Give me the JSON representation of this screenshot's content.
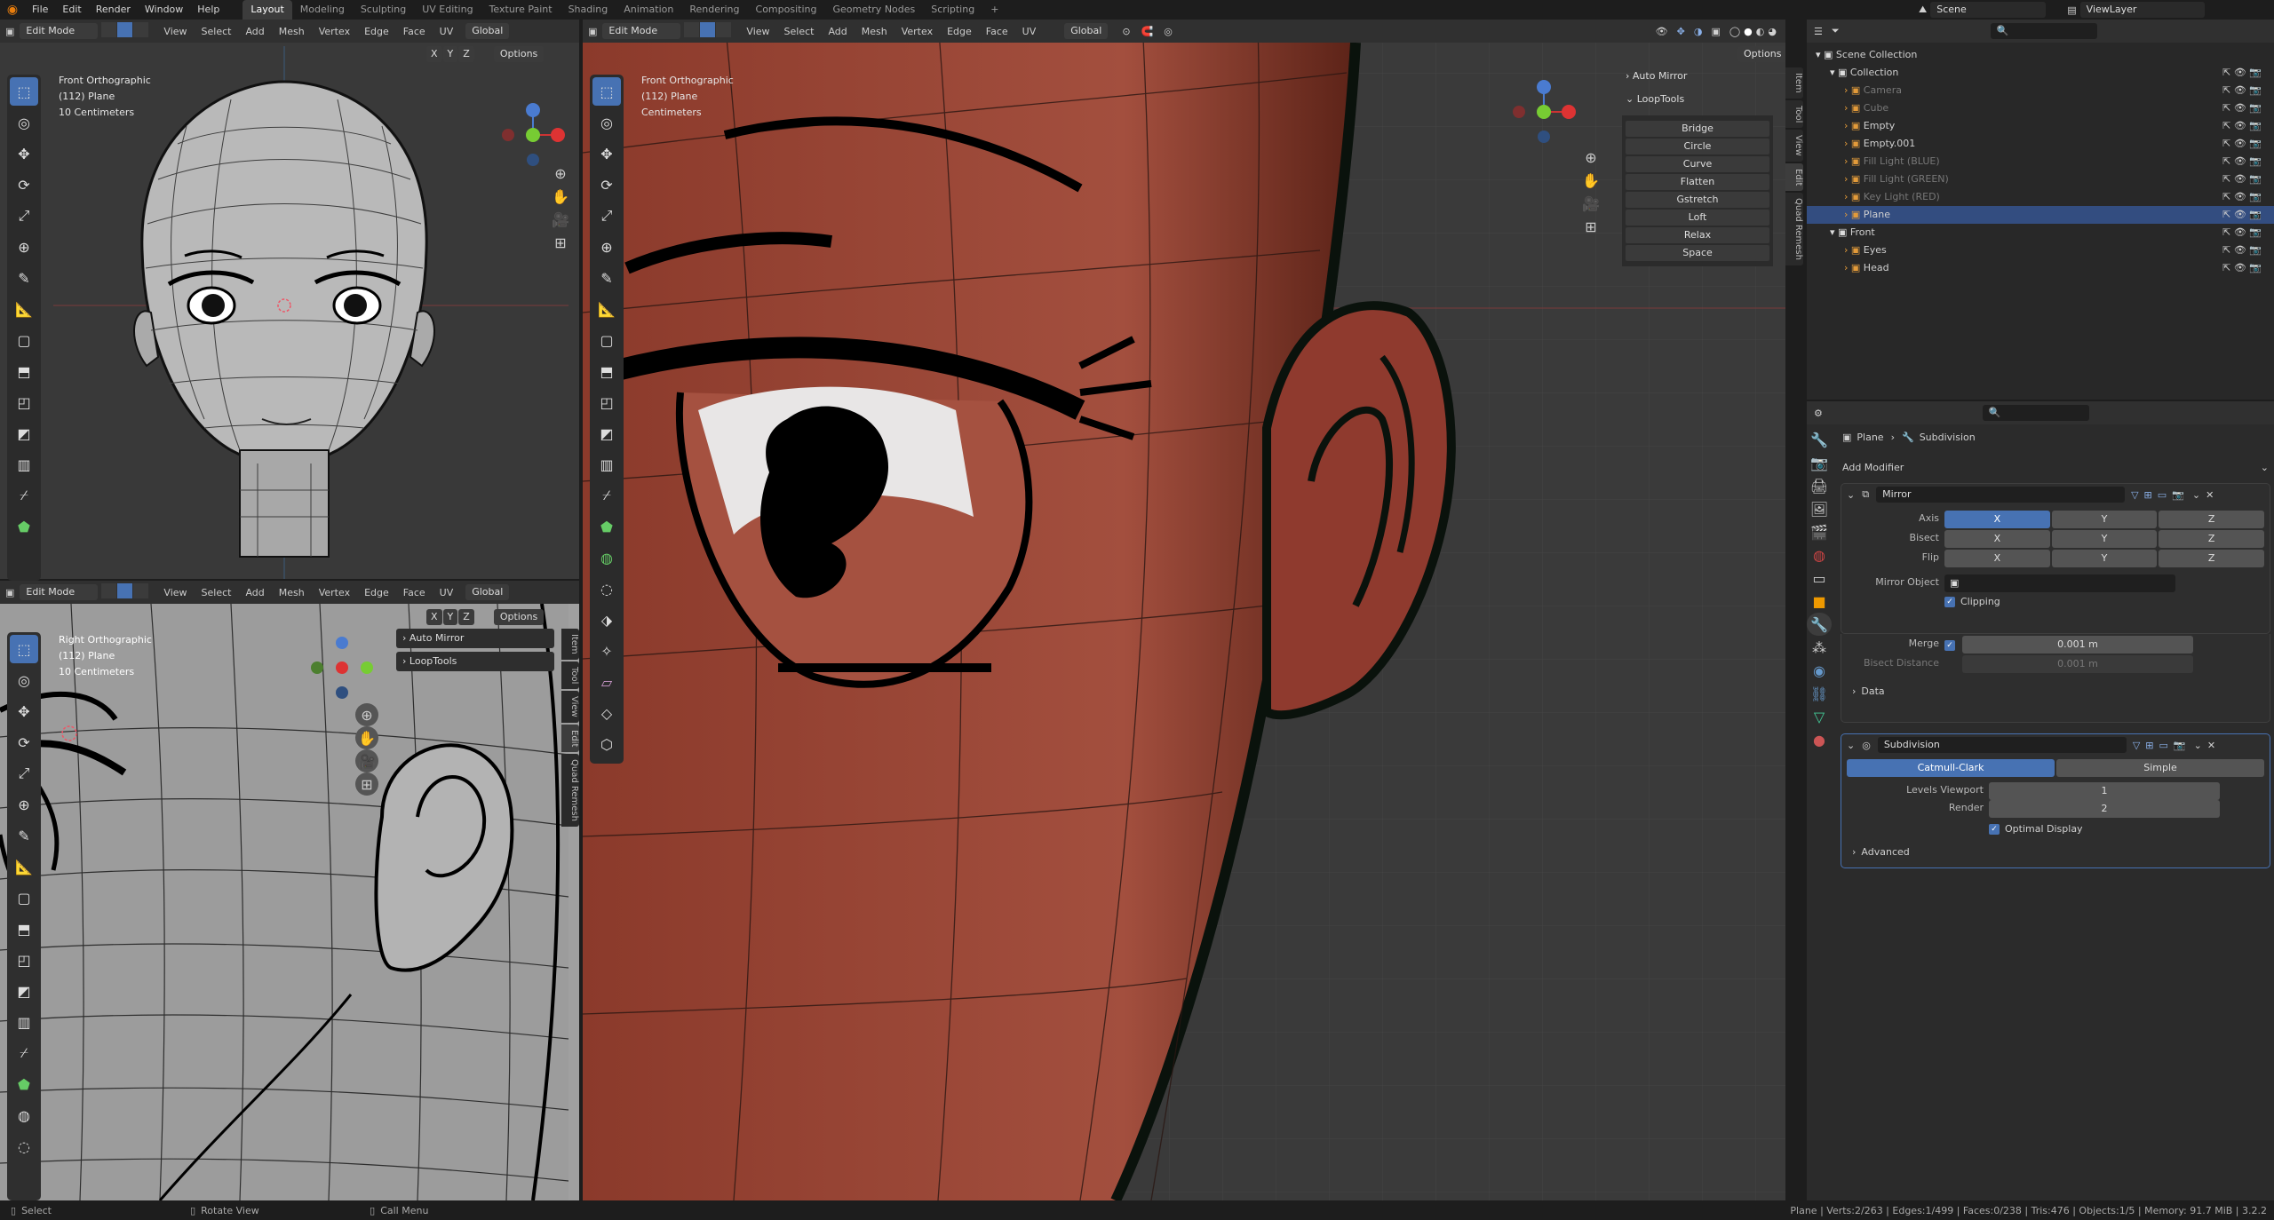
{
  "topbar": {
    "menus": [
      "File",
      "Edit",
      "Render",
      "Window",
      "Help"
    ],
    "workspaces": [
      "Layout",
      "Modeling",
      "Sculpting",
      "UV Editing",
      "Texture Paint",
      "Shading",
      "Animation",
      "Rendering",
      "Compositing",
      "Geometry Nodes",
      "Scripting"
    ],
    "active_workspace": "Layout",
    "add_tab": "+",
    "scene": "Scene",
    "view_layer": "ViewLayer"
  },
  "viewport_top_left": {
    "mode": "Edit Mode",
    "menus": [
      "View",
      "Select",
      "Add",
      "Mesh",
      "Vertex",
      "Edge",
      "Face",
      "UV"
    ],
    "orientation": "Global",
    "axes": [
      "X",
      "Y",
      "Z"
    ],
    "options": "Options",
    "overlay": [
      "Front Orthographic",
      "(112) Plane",
      "10 Centimeters"
    ]
  },
  "viewport_bottom_left": {
    "mode": "Edit Mode",
    "menus": [
      "View",
      "Select",
      "Add",
      "Mesh",
      "Vertex",
      "Edge",
      "Face",
      "UV"
    ],
    "orientation": "Global",
    "axes": [
      "X",
      "Y",
      "Z"
    ],
    "options": "Options",
    "overlay": [
      "Right Orthographic",
      "(112) Plane",
      "10 Centimeters"
    ],
    "panels": [
      "Auto Mirror",
      "LoopTools"
    ],
    "tabs": [
      "Item",
      "Tool",
      "View",
      "Edit",
      "Quad Remesh"
    ]
  },
  "viewport_main": {
    "mode": "Edit Mode",
    "menus": [
      "View",
      "Select",
      "Add",
      "Mesh",
      "Vertex",
      "Edge",
      "Face",
      "UV"
    ],
    "orientation": "Global",
    "options": "Options",
    "overlay": [
      "Front Orthographic",
      "(112) Plane",
      "Centimeters"
    ],
    "panel_auto_mirror": "Auto Mirror",
    "panel_looptools": "LoopTools",
    "looptools_buttons": [
      "Bridge",
      "Circle",
      "Curve",
      "Flatten",
      "Gstretch",
      "Loft",
      "Relax",
      "Space"
    ],
    "tabs": [
      "Item",
      "Tool",
      "View",
      "Edit",
      "Quad Remesh"
    ]
  },
  "outliner": {
    "rows": [
      {
        "label": "Scene Collection",
        "depth": 0
      },
      {
        "label": "Collection",
        "depth": 1
      },
      {
        "label": "Camera",
        "depth": 2,
        "dim": true
      },
      {
        "label": "Cube",
        "depth": 2,
        "dim": true
      },
      {
        "label": "Empty",
        "depth": 2
      },
      {
        "label": "Empty.001",
        "depth": 2
      },
      {
        "label": "Fill Light (BLUE)",
        "depth": 2,
        "dim": true
      },
      {
        "label": "Fill Light (GREEN)",
        "depth": 2,
        "dim": true
      },
      {
        "label": "Key Light (RED)",
        "depth": 2,
        "dim": true
      },
      {
        "label": "Plane",
        "depth": 2,
        "selected": true
      },
      {
        "label": "Front",
        "depth": 1
      },
      {
        "label": "Eyes",
        "depth": 2
      },
      {
        "label": "Head",
        "depth": 2
      }
    ]
  },
  "properties": {
    "breadcrumb_object": "Plane",
    "breadcrumb_modifier": "Subdivision",
    "add_modifier": "Add Modifier",
    "mirror": {
      "name": "Mirror",
      "axis_label": "Axis",
      "bisect_label": "Bisect",
      "flip_label": "Flip",
      "xyz": [
        "X",
        "Y",
        "Z"
      ],
      "mirror_object_label": "Mirror Object",
      "clipping": "Clipping",
      "merge_label": "Merge",
      "merge_value": "0.001 m",
      "bisect_distance_label": "Bisect Distance",
      "bisect_distance_value": "0.001 m",
      "data": "Data"
    },
    "subdivision": {
      "name": "Subdivision",
      "catmull": "Catmull-Clark",
      "simple": "Simple",
      "levels_label": "Levels Viewport",
      "levels_value": "1",
      "render_label": "Render",
      "render_value": "2",
      "optimal": "Optimal Display",
      "advanced": "Advanced"
    }
  },
  "statusbar": {
    "select": "Select",
    "rotate": "Rotate View",
    "call_menu": "Call Menu",
    "stats": "Plane | Verts:2/263 | Edges:1/499 | Faces:0/238 | Tris:476 | Objects:1/5 | Memory: 91.7 MiB | 3.2.2"
  },
  "colors": {
    "skin": "#8a3a2c",
    "accent": "#4772b3",
    "grid_bg": "#3a3a3a"
  }
}
